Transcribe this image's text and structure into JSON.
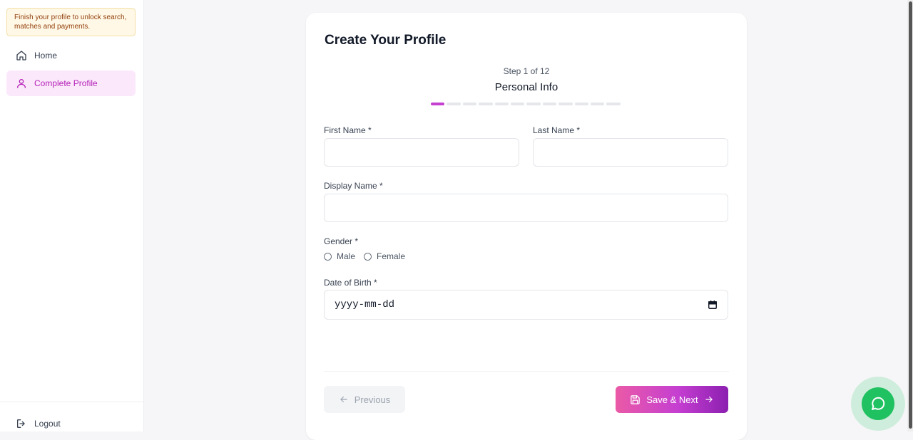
{
  "sidebar": {
    "notice": "Finish your profile to unlock search, matches and payments.",
    "items": [
      {
        "label": "Home",
        "icon": "home-icon"
      },
      {
        "label": "Complete Profile",
        "icon": "user-icon"
      }
    ],
    "logout": {
      "label": "Logout",
      "icon": "logout-icon"
    }
  },
  "card": {
    "title": "Create Your Profile",
    "step_counter": "Step 1 of 12",
    "step_name": "Personal Info",
    "progress": {
      "current": 1,
      "total": 12
    }
  },
  "form": {
    "first_name": {
      "label": "First Name *",
      "value": ""
    },
    "last_name": {
      "label": "Last Name *",
      "value": ""
    },
    "display_name": {
      "label": "Display Name *",
      "value": ""
    },
    "gender": {
      "label": "Gender *",
      "options": [
        "Male",
        "Female"
      ]
    },
    "dob": {
      "label": "Date of Birth *",
      "placeholder": "yyyy-mm-dd",
      "icon": "calendar-icon"
    }
  },
  "buttons": {
    "previous": "Previous",
    "save_next": "Save & Next"
  },
  "colors": {
    "accent": "#c53fd1",
    "active_nav_bg": "#fbe9fb",
    "chat": "#1fc160"
  }
}
